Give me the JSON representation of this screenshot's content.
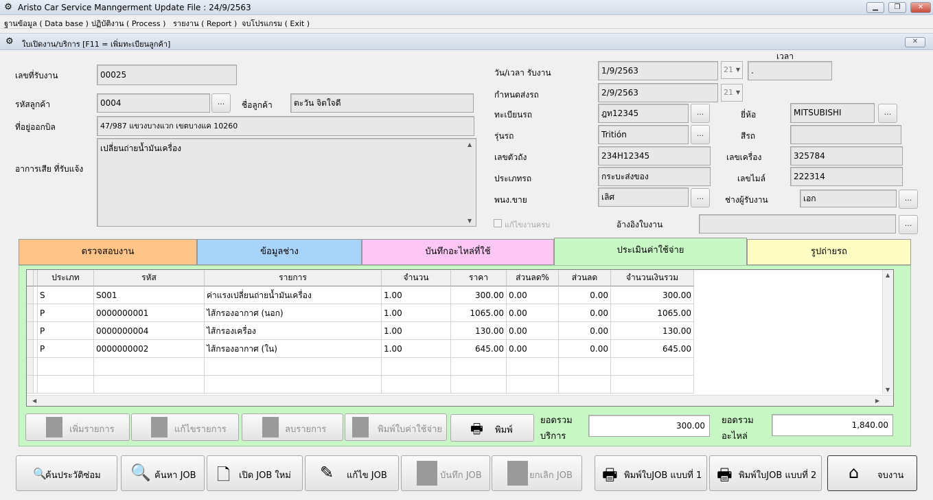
{
  "window": {
    "title": "Aristo Car Service Manngerment   Update File : 24/9/2563",
    "minimize": "▁",
    "restore": "❐",
    "close": "✕"
  },
  "menu": [
    "ฐานข้อมูล ( Data base )",
    "ปฏิบัติงาน ( Process )",
    "รายงาน ( Report )",
    "จบโปรแกรม ( Exit )"
  ],
  "form": {
    "title": "ใบเปิดงาน/บริการ  [F11 = เพิ่มทะเบียนลูกค้า]",
    "close": "✕",
    "dots": "...",
    "left": {
      "job_no_label": "เลขที่รับงาน",
      "job_no": "00025",
      "cust_code_label": "รหัสลูกค้า",
      "cust_code": "0004",
      "cust_name_label": "ชื่อลูกค้า",
      "cust_name": "ตะวัน จิตใจดี",
      "address_label": "ที่อยู่ออกบิล",
      "address": "47/987  แขวงบางแวก เขตบางแค  10260",
      "symptom_label": "อาการเสีย ที่รับแจ้ง",
      "symptom": "เปลี่ยนถ่ายน้ำมันเครื่อง"
    },
    "right": {
      "time_label": "เวลา",
      "recv_date_label": "วัน/เวลา รับงาน",
      "recv_date": "1/9/2563",
      "recv_combo": "21",
      "time_value": ".",
      "due_label": "กำหนดส่งรถ",
      "due_date": "2/9/2563",
      "due_combo": "21",
      "plate_label": "ทะเบียนรถ",
      "plate": "ฎท12345",
      "brand_label": "ยี่ห้อ",
      "brand": "MITSUBISHI",
      "model_label": "รุ่นรถ",
      "model": "Tritión",
      "color_label": "สีรถ",
      "color": "",
      "chassis_label": "เลขตัวถัง",
      "chassis": "234H12345",
      "engine_label": "เลขเครื่อง",
      "engine": "325784",
      "type_label": "ประเภทรถ",
      "type": "กระบะส่งของ",
      "mileage_label": "เลขไมล์",
      "mileage": "222314",
      "sales_label": "พนง.ขาย",
      "sales": "เลิศ",
      "advisor_label": "ช่างผู้รับงาน",
      "advisor": "เอก",
      "fixed_label": "แก้ไขงานครบ",
      "ref_label": "อ้างอิงใบงาน",
      "ref": ""
    },
    "tabs": [
      {
        "label": "ตรวจสอบงาน",
        "color": "#ffc488"
      },
      {
        "label": "ข้อมูลช่าง",
        "color": "#a9d4fa"
      },
      {
        "label": "บันทึกอะไหล่ที่ใช้",
        "color": "#fcc6f5"
      },
      {
        "label": "ประเมินค่าใช้จ่าย",
        "color": "#c8f7c5"
      },
      {
        "label": "รูปถ่ายรถ",
        "color": "#fdfdc4"
      }
    ],
    "grid": {
      "headers": [
        "ประเภท",
        "รหัส",
        "รายการ",
        "จำนวน",
        "ราคา",
        "ส่วนลด%",
        "ส่วนลด",
        "จำนวนเงินรวม"
      ],
      "rows": [
        [
          "S",
          "S001",
          "ค่าแรงเปลี่ยนถ่ายน้ำมันเครื่อง",
          "1.00",
          "300.00",
          "0.00",
          "0.00",
          "300.00"
        ],
        [
          "P",
          "0000000001",
          "ไส้กรองอากาศ (นอก)",
          "1.00",
          "1065.00",
          "0.00",
          "0.00",
          "1065.00"
        ],
        [
          "P",
          "0000000004",
          "ไส้กรองเครื่อง",
          "1.00",
          "130.00",
          "0.00",
          "0.00",
          "130.00"
        ],
        [
          "P",
          "0000000002",
          "ไส้กรองอากาศ (ใน)",
          "1.00",
          "645.00",
          "0.00",
          "0.00",
          "645.00"
        ]
      ]
    },
    "panel_buttons": {
      "add": "เพิ่มรายการ",
      "edit": "แก้ไขรายการ",
      "delete": "ลบรายการ",
      "print_estimate": "พิมพ์ใบค่าใช้จ่าย",
      "print": "พิมพ์"
    },
    "totals": {
      "service_label_1": "ยอดรวม",
      "service_label_2": "บริการ",
      "service_total": "300.00",
      "parts_label_1": "ยอดรวม",
      "parts_label_2": "อะไหล่",
      "parts_total": "1,840.00"
    },
    "bottom_buttons": {
      "history": "ค้นประวัติซ่อม",
      "search": "ค้นหา JOB",
      "new": "เปิด JOB ใหม่",
      "edit": "แก้ไข JOB",
      "save": "บันทึก JOB",
      "cancel": "ยกเลิก JOB",
      "print1": "พิมพ์ใบJOB แบบที่ 1",
      "print2": "พิมพ์ใบJOB แบบที่ 2",
      "finish": "จบงาน"
    }
  }
}
